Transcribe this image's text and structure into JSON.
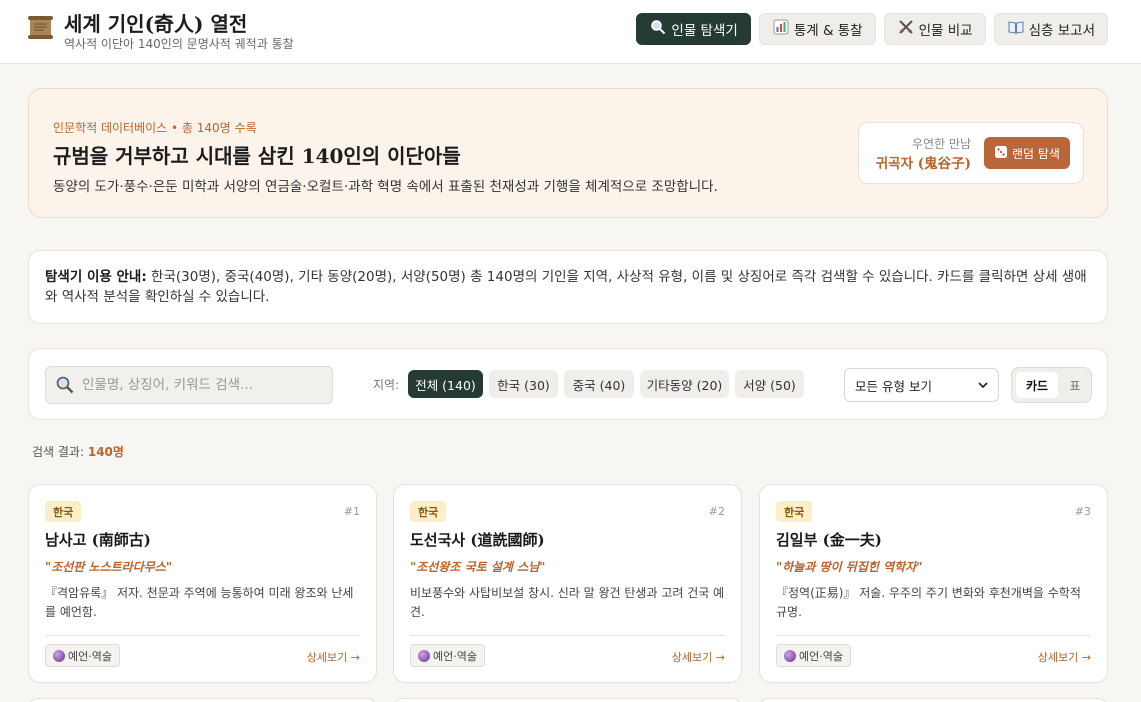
{
  "header": {
    "title": "세계 기인(奇人) 열전",
    "subtitle": "역사적 이단아 140인의 문명사적 궤적과 통찰",
    "nav": [
      {
        "label": "인물 탐색기",
        "icon": "magnifier-icon",
        "active": true
      },
      {
        "label": "통계 & 통찰",
        "icon": "bar-chart-icon",
        "active": false
      },
      {
        "label": "인물 비교",
        "icon": "crossed-swords-icon",
        "active": false
      },
      {
        "label": "심층 보고서",
        "icon": "open-book-icon",
        "active": false
      }
    ]
  },
  "hero": {
    "kicker": "인문학적 데이터베이스  •  총 140명 수록",
    "title": "규범을 거부하고 시대를 삼킨 140인의 이단아들",
    "description": "동양의 도가·풍수·은둔 미학과 서양의 연금술·오컬트·과학 혁명 속에서 표출된 천재성과 기행을 체계적으로 조망합니다.",
    "random_label": "우연한 만남",
    "random_name": "귀곡자 (鬼谷子)",
    "random_button": "랜덤 탐색",
    "random_icon": "dice-icon"
  },
  "guide": {
    "lead": "탐색기 이용 안내:",
    "text": " 한국(30명), 중국(40명), 기타 동양(20명), 서양(50명) 총 140명의 기인을 지역, 사상적 유형, 이름 및 상징어로 즉각 검색할 수 있습니다. 카드를 클릭하면 상세 생애와 역사적 분석을 확인하실 수 있습니다."
  },
  "filter": {
    "search_placeholder": "인물명, 상징어, 키워드 검색...",
    "region_label": "지역:",
    "regions": [
      "전체 (140)",
      "한국 (30)",
      "중국 (40)",
      "기타동양 (20)",
      "서양 (50)"
    ],
    "active_region": "전체 (140)",
    "type_select": "모든 유형 보기",
    "view_options": [
      "카드",
      "표"
    ],
    "active_view": "카드"
  },
  "results": {
    "label": "검색 결과:",
    "count": "140명"
  },
  "cards": [
    {
      "region": "한국",
      "number": "#1",
      "name": "남사고 (南師古)",
      "epithet": "\"조선판 노스트라다무스\"",
      "description": "『격암유록』 저자. 천문과 주역에 능통하여 미래 왕조와 난세를 예언함.",
      "tag": "예언·역술",
      "tag_icon": "crystal-ball-icon",
      "detail": "상세보기 →"
    },
    {
      "region": "한국",
      "number": "#2",
      "name": "도선국사 (道詵國師)",
      "epithet": "\"조선왕조 국토 설계 스님\"",
      "description": "비보풍수와 사탑비보설 창시. 신라 말 왕건 탄생과 고려 건국 예견.",
      "tag": "예언·역술",
      "tag_icon": "crystal-ball-icon",
      "detail": "상세보기 →"
    },
    {
      "region": "한국",
      "number": "#3",
      "name": "김일부 (金一夫)",
      "epithet": "\"하늘과 땅이 뒤집힌 역학자\"",
      "description": "『정역(正易)』 저술. 우주의 주기 변화와 후천개벽을 수학적 규명.",
      "tag": "예언·역술",
      "tag_icon": "crystal-ball-icon",
      "detail": "상세보기 →"
    }
  ],
  "colors": {
    "primary_dark": "#243a32",
    "accent": "#b8642c",
    "hero_bg": "#fcf3eb",
    "badge_bg": "#fbeec8"
  }
}
